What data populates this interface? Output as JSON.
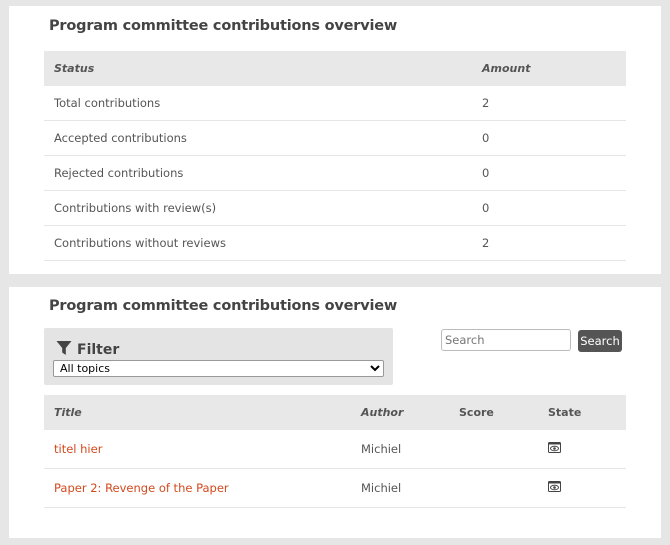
{
  "summary": {
    "title": "Program committee contributions overview",
    "headers": {
      "status": "Status",
      "amount": "Amount"
    },
    "rows": [
      {
        "label": "Total contributions",
        "value": "2"
      },
      {
        "label": "Accepted contributions",
        "value": "0"
      },
      {
        "label": "Rejected contributions",
        "value": "0"
      },
      {
        "label": "Contributions with review(s)",
        "value": "0"
      },
      {
        "label": "Contributions without reviews",
        "value": "2"
      }
    ]
  },
  "contributions": {
    "title": "Program committee contributions overview",
    "filter": {
      "label": "Filter",
      "icon": "filter-icon",
      "selected": "All topics"
    },
    "search": {
      "placeholder": "Search",
      "button": "Search"
    },
    "headers": {
      "title": "Title",
      "author": "Author",
      "score": "Score",
      "state": "State"
    },
    "rows": [
      {
        "title": "titel hier",
        "author": "Michiel",
        "score": "",
        "state_icon": "eye-icon"
      },
      {
        "title": "Paper 2: Revenge of the Paper",
        "author": "Michiel",
        "score": "",
        "state_icon": "eye-icon"
      }
    ]
  },
  "colors": {
    "link": "#d24a1f",
    "header_bg": "#e8e8e8",
    "button_bg": "#555555"
  }
}
